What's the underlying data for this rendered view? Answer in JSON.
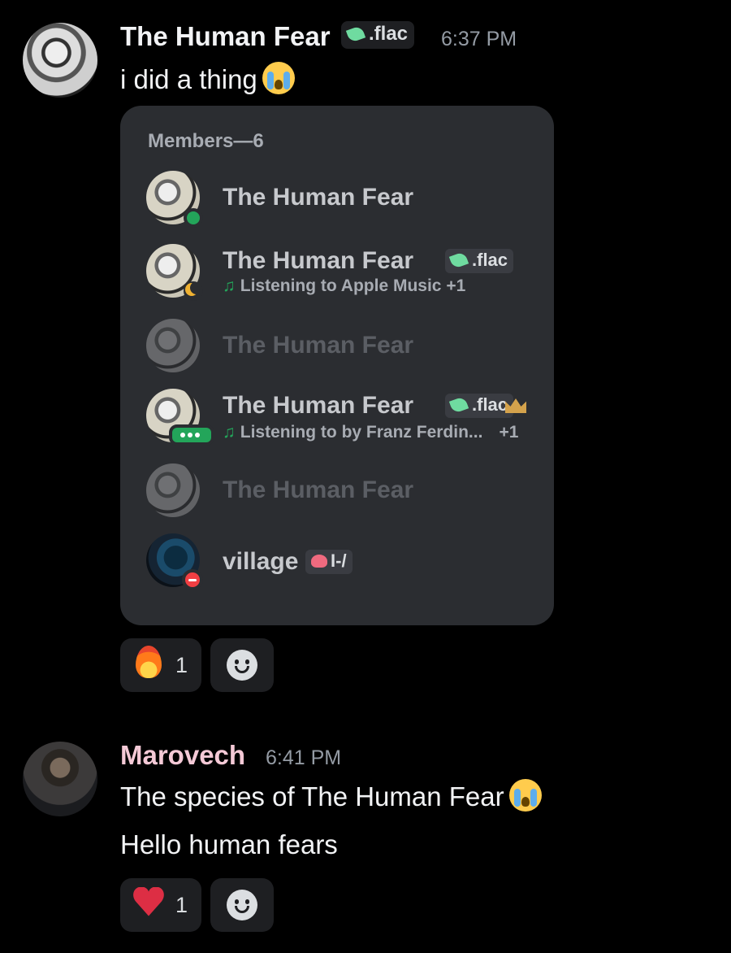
{
  "messages": [
    {
      "author": "The Human Fear",
      "tag": ".flac",
      "time": "6:37 PM",
      "text": "i did a thing",
      "emoji": "loudly-crying-face",
      "embed": {
        "header": "Members—6",
        "members": [
          {
            "name": "The Human Fear",
            "status": "online"
          },
          {
            "name": "The Human Fear",
            "tag": ".flac",
            "status": "idle",
            "activity": "Listening to Apple Music",
            "extra": "+1"
          },
          {
            "name": "The Human Fear",
            "status": "offline"
          },
          {
            "name": "The Human Fear",
            "tag": ".flac",
            "status": "mobile",
            "owner": true,
            "activity": "Listening to by Franz Ferdin...",
            "extra": "+1"
          },
          {
            "name": "The Human Fear",
            "status": "offline"
          },
          {
            "name": "village",
            "tag": "I-/",
            "status": "dnd"
          }
        ]
      },
      "reactions": [
        {
          "emoji": "fire",
          "count": "1"
        }
      ]
    },
    {
      "author": "Marovech",
      "author_color": "#f4c9d6",
      "time": "6:41 PM",
      "text": "The species of The Human Fear",
      "emoji": "loudly-crying-face",
      "text2": "Hello human fears",
      "reactions": [
        {
          "emoji": "red-heart",
          "count": "1"
        }
      ]
    }
  ]
}
